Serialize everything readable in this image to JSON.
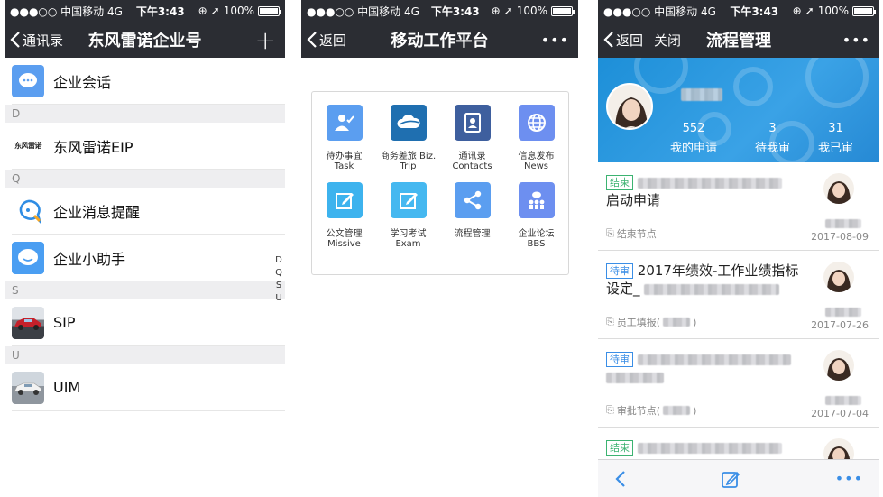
{
  "status_bar": {
    "carrier": "●●●○○ 中国移动  4G",
    "time": "下午3:43",
    "battery": "100%"
  },
  "screen1": {
    "back_label": "通讯录",
    "title": "东风雷诺企业号",
    "add_symbol": "+",
    "rows": [
      {
        "label": "企业会话",
        "icon": "chat-bubble-icon"
      },
      {
        "section": "D"
      },
      {
        "label": "东风雷诺EIP",
        "icon": "dongfeng-renault-logo",
        "logo_text": "东风雷诺"
      },
      {
        "section": "Q"
      },
      {
        "label": "企业消息提醒",
        "icon": "message-alert-icon"
      },
      {
        "label": "企业小助手",
        "icon": "assistant-bubble-icon"
      },
      {
        "section": "S"
      },
      {
        "label": "SIP",
        "icon": "red-car-thumbnail"
      },
      {
        "section": "U"
      },
      {
        "label": "UIM",
        "icon": "white-car-thumbnail"
      }
    ],
    "index_letters": [
      "D",
      "Q",
      "S",
      "U"
    ]
  },
  "screen2": {
    "back_label": "返回",
    "title": "移动工作平台",
    "more_symbol": "•••",
    "apps": [
      {
        "cn": "待办事宜",
        "en": "Task",
        "icon": "task-person-icon",
        "color": "#5b9ef0"
      },
      {
        "cn": "商务差旅 Biz.",
        "en": "Trip",
        "icon": "cloud-trip-icon",
        "color": "#1f6fb0"
      },
      {
        "cn": "通讯录",
        "en": "Contacts",
        "icon": "contacts-book-icon",
        "color": "#3e5f9e"
      },
      {
        "cn": "信息发布",
        "en": "News",
        "icon": "globe-icon",
        "color": "#6d8ff0"
      },
      {
        "cn": "公文管理",
        "en": "Missive",
        "icon": "edit-document-icon",
        "color": "#3db3ee"
      },
      {
        "cn": "学习考试",
        "en": "Exam",
        "icon": "exam-edit-icon",
        "color": "#45b8f0"
      },
      {
        "cn": "流程管理",
        "en": "",
        "icon": "share-flow-icon",
        "color": "#5b9ef0"
      },
      {
        "cn": "企业论坛",
        "en": "BBS",
        "icon": "forum-people-icon",
        "color": "#6d8ff0"
      }
    ]
  },
  "screen3": {
    "back_label": "返回",
    "close_label": "关闭",
    "title": "流程管理",
    "more_symbol": "•••",
    "stats": [
      {
        "value": "552",
        "label": "我的申请"
      },
      {
        "value": "3",
        "label": "待我审"
      },
      {
        "value": "31",
        "label": "我已审"
      }
    ],
    "items": [
      {
        "badge": "结束",
        "title": "启动申请",
        "node": "结束节点",
        "date": "2017-08-09",
        "status": "done"
      },
      {
        "badge": "待审",
        "title": "2017年绩效-工作业绩指标设定_",
        "node": "员工填报(",
        "node_suffix": ")",
        "date": "2017-07-26",
        "status": "pending"
      },
      {
        "badge": "待审",
        "title": "",
        "node": "审批节点(",
        "node_suffix": ")",
        "date": "2017-07-04",
        "status": "pending"
      },
      {
        "badge": "结束",
        "title": "",
        "node": "",
        "date": "",
        "status": "done"
      }
    ],
    "colors": {
      "done": "#3cb371",
      "pending": "#3a8ee6",
      "banner": "#2a96e0"
    }
  }
}
